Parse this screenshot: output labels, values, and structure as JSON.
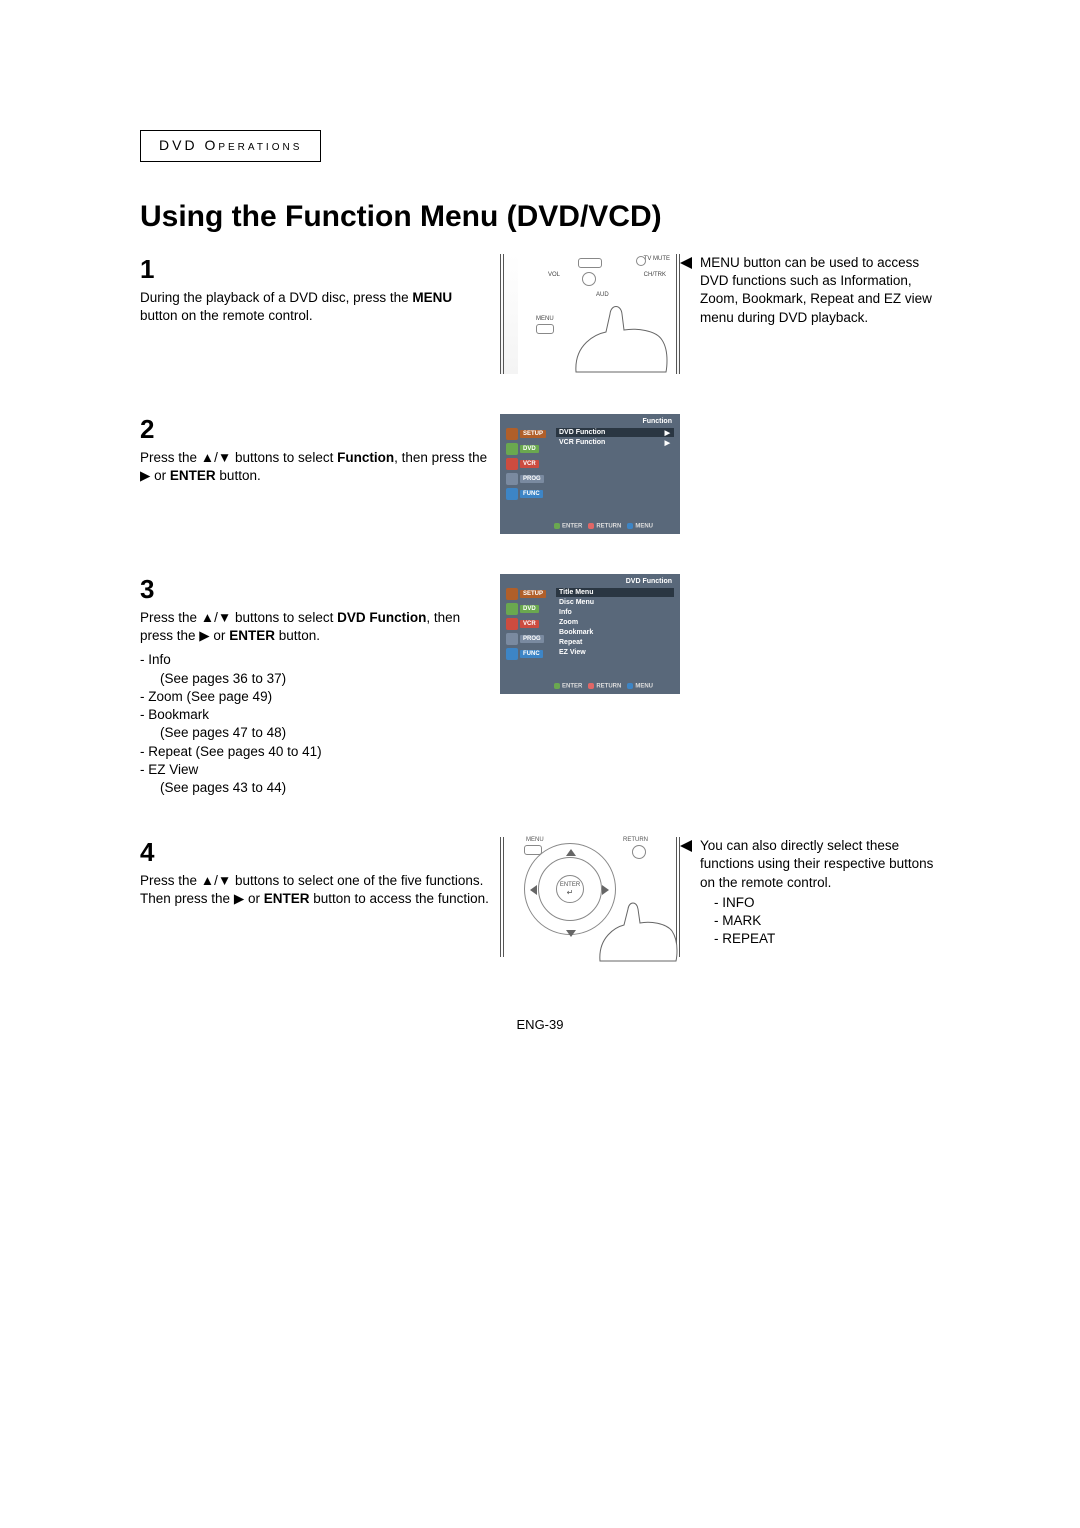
{
  "header": {
    "section": "DVD Operations"
  },
  "title": "Using the Function Menu (DVD/VCD)",
  "steps": {
    "s1": {
      "num": "1",
      "text_before": "During the playback of a DVD disc, press the ",
      "bold": "MENU",
      "text_after": " button on the remote control."
    },
    "s2": {
      "num": "2",
      "text_a": "Press the ",
      "text_b": " buttons to select ",
      "bold1": "Function",
      "text_c": ", then press the ",
      "text_d": " or ",
      "bold2": "ENTER",
      "text_e": " button."
    },
    "s3": {
      "num": "3",
      "text_a": "Press the ",
      "text_b": " buttons to select ",
      "bold1": "DVD Function",
      "text_c": ", then press the ",
      "text_d": " or ",
      "bold2": "ENTER",
      "text_e": " button.",
      "items": [
        "Info",
        "(See pages 36 to 37)",
        "Zoom (See page 49)",
        "Bookmark",
        "(See pages 47 to 48)",
        "Repeat (See pages 40 to 41)",
        "EZ View",
        "(See pages 43 to 44)"
      ]
    },
    "s4": {
      "num": "4",
      "text_a": "Press the ",
      "text_b": " buttons to select one of the five functions. Then press the ",
      "text_c": " or ",
      "bold1": "ENTER",
      "text_d": " button to access the function."
    }
  },
  "remote_top": {
    "tv_mute": "TV MUTE",
    "vol": "VOL",
    "ch": "CH/TRK",
    "aud": "AUD",
    "menu": "MENU"
  },
  "osd1": {
    "title": "Function",
    "side": [
      "SETUP",
      "DVD",
      "VCR",
      "PROG",
      "FUNC"
    ],
    "side_colors": [
      "#b05f2a",
      "#6aa84f",
      "#cc4c3f",
      "#7a8aa0",
      "#3d85c6"
    ],
    "items": [
      "DVD Function",
      "VCR Function"
    ],
    "foot": {
      "enter": "ENTER",
      "return": "RETURN",
      "menu": "MENU"
    }
  },
  "osd2": {
    "title": "DVD Function",
    "side": [
      "SETUP",
      "DVD",
      "VCR",
      "PROG",
      "FUNC"
    ],
    "side_colors": [
      "#b05f2a",
      "#6aa84f",
      "#cc4c3f",
      "#7a8aa0",
      "#3d85c6"
    ],
    "items": [
      "Title Menu",
      "Disc Menu",
      "Info",
      "Zoom",
      "Bookmark",
      "Repeat",
      "EZ View"
    ],
    "foot": {
      "enter": "ENTER",
      "return": "RETURN",
      "menu": "MENU"
    }
  },
  "nav": {
    "menu": "MENU",
    "return": "RETURN",
    "enter": "ENTER"
  },
  "note1": "MENU button can be used to access DVD functions such as Information, Zoom, Bookmark, Repeat and EZ view menu during DVD playback.",
  "note4": {
    "text": "You can also directly select these functions using their respective buttons on the remote control.",
    "items": [
      "INFO",
      "MARK",
      "REPEAT"
    ]
  },
  "footer": "ENG-39"
}
